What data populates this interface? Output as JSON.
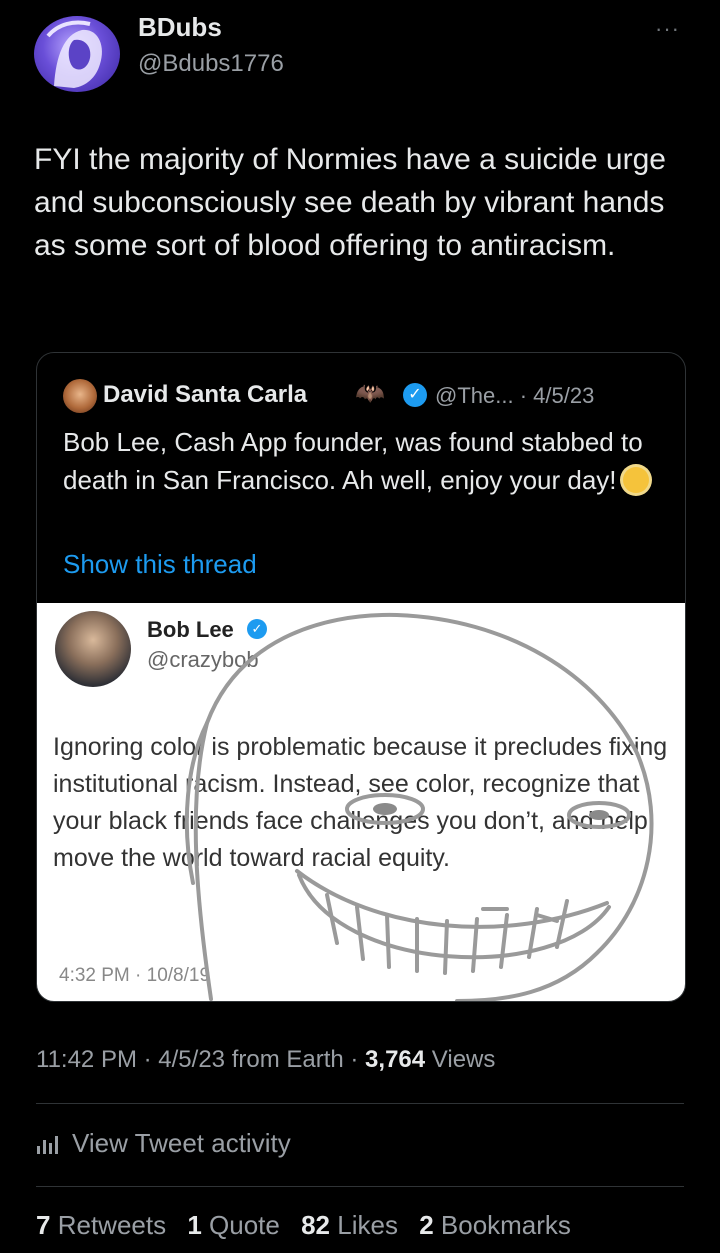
{
  "author": {
    "name": "BDubs",
    "handle": "@Bdubs1776",
    "more_label": "···"
  },
  "tweet": {
    "text": "FYI the majority of Normies have a suicide urge and subconsciously see death by vibrant hands as some sort of blood offering to antiracism."
  },
  "quote": {
    "name": "David Santa Carla",
    "emoji": "🦇",
    "handle": "@The...",
    "date": "4/5/23",
    "text": "Bob Lee, Cash App founder, was found stabbed to death in San Francisco. Ah well, enjoy your day!",
    "show_thread": "Show this thread",
    "embedded": {
      "name": "Bob Lee",
      "handle": "@crazybob",
      "text": "Ignoring color is problematic because it precludes fixing institutional racism. Instead, see color, recognize that your black friends face challenges you don’t, and help move the world toward racial equity.",
      "time": "4:32 PM · 10/8/19"
    }
  },
  "meta": {
    "time": "11:42 PM",
    "date": "4/5/23",
    "source": "from Earth",
    "views_count": "3,764",
    "views_label": "Views"
  },
  "activity": {
    "label": "View Tweet activity"
  },
  "stats": {
    "retweets_count": "7",
    "retweets_label": "Retweets",
    "quotes_count": "1",
    "quotes_label": "Quote",
    "likes_count": "82",
    "likes_label": "Likes",
    "bookmarks_count": "2",
    "bookmarks_label": "Bookmarks"
  },
  "colors": {
    "background": "#000000",
    "link": "#1d9bf0",
    "secondary_text": "#9a9fa5"
  }
}
